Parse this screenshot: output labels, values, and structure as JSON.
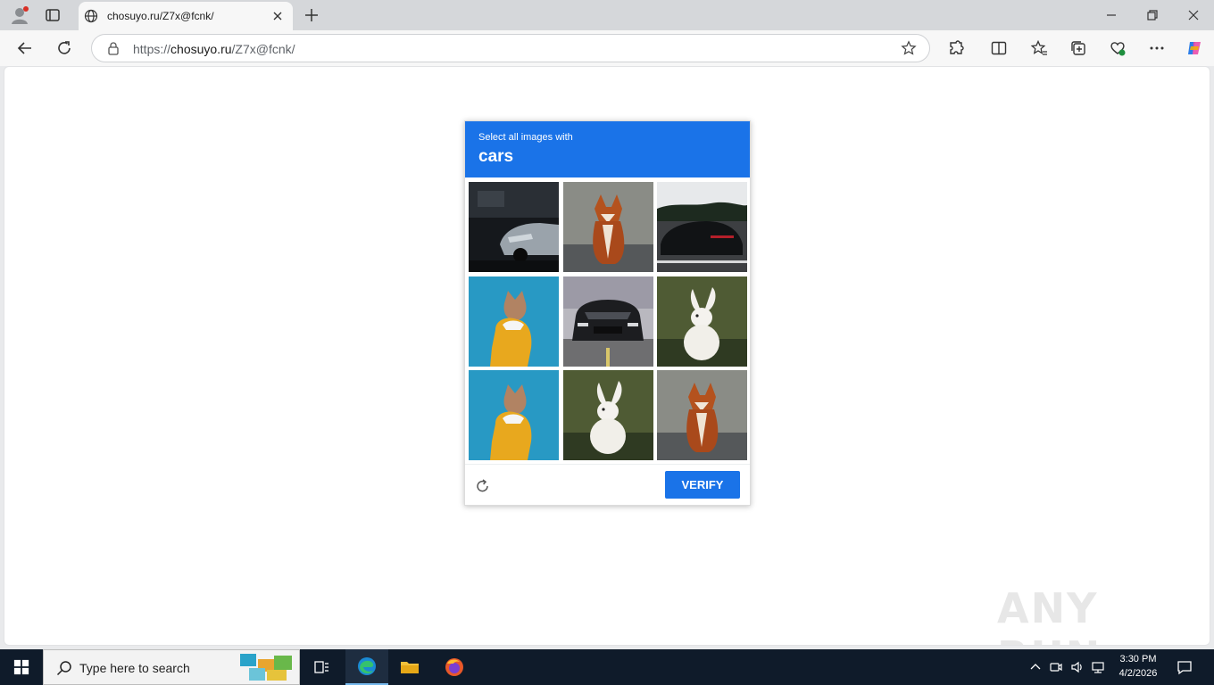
{
  "browser": {
    "tab_title": "chosuyo.ru/Z7x@fcnk/",
    "url_scheme": "https://",
    "url_host": "chosuyo.ru",
    "url_path": "/Z7x@fcnk/"
  },
  "captcha": {
    "prompt": "Select all images with",
    "target": "cars",
    "verify_label": "VERIFY",
    "tiles": [
      "car",
      "fox",
      "car",
      "dog",
      "car",
      "rabbit",
      "dog",
      "rabbit",
      "fox"
    ]
  },
  "watermark": "ANY RUN",
  "taskbar": {
    "search_placeholder": "Type here to search",
    "time": "3:30 PM",
    "date": "4/2/2026"
  },
  "colors": {
    "captcha_header": "#1a73e8",
    "verify_button": "#1a73e8",
    "taskbar": "#0f1b2a"
  }
}
